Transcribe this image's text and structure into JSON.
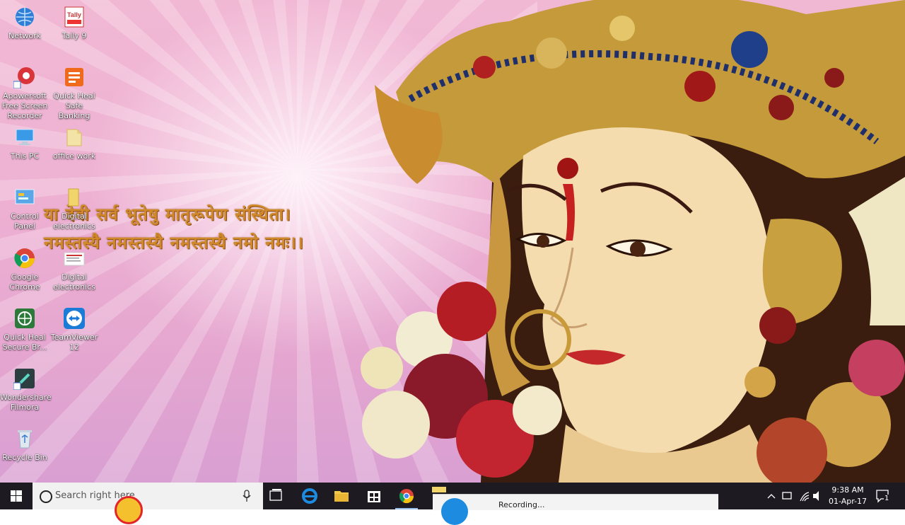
{
  "desktop": {
    "mantra_line1": "या देवी सर्व भूतेषु मातृरूपेण संस्थिता।",
    "mantra_line2": "नमस्तस्यै नमस्तस्यै नमस्तस्यै नमो नमः।।",
    "icons": [
      {
        "label": "Network",
        "icon": "network-icon"
      },
      {
        "label": "Tally 9",
        "icon": "tally-icon"
      },
      {
        "label": "Apowersoft Free Screen Recorder",
        "icon": "apowersoft-icon"
      },
      {
        "label": "Quick Heal Safe Banking",
        "icon": "quick-heal-safe-banking-icon"
      },
      {
        "label": "This PC",
        "icon": "computer-icon"
      },
      {
        "label": "office work",
        "icon": "folder-icon"
      },
      {
        "label": "Control Panel",
        "icon": "control-panel-icon"
      },
      {
        "label": "Digital electronics",
        "icon": "folder-icon"
      },
      {
        "label": "Google Chrome",
        "icon": "chrome-icon"
      },
      {
        "label": "Digital electronics",
        "icon": "document-icon"
      },
      {
        "label": "Quick Heal Secure Br...",
        "icon": "quick-heal-browser-icon"
      },
      {
        "label": "TeamViewer 12",
        "icon": "teamviewer-icon"
      },
      {
        "label": "Wondershare Filmora",
        "icon": "filmora-icon"
      },
      {
        "label": "Recycle Bin",
        "icon": "recycle-bin-icon"
      }
    ]
  },
  "taskbar": {
    "search_placeholder": "Search right here",
    "recording_label": "Recording...",
    "time": "9:38 AM",
    "date": "01-Apr-17",
    "notification_count": "1",
    "accent": "#1c8be0"
  }
}
